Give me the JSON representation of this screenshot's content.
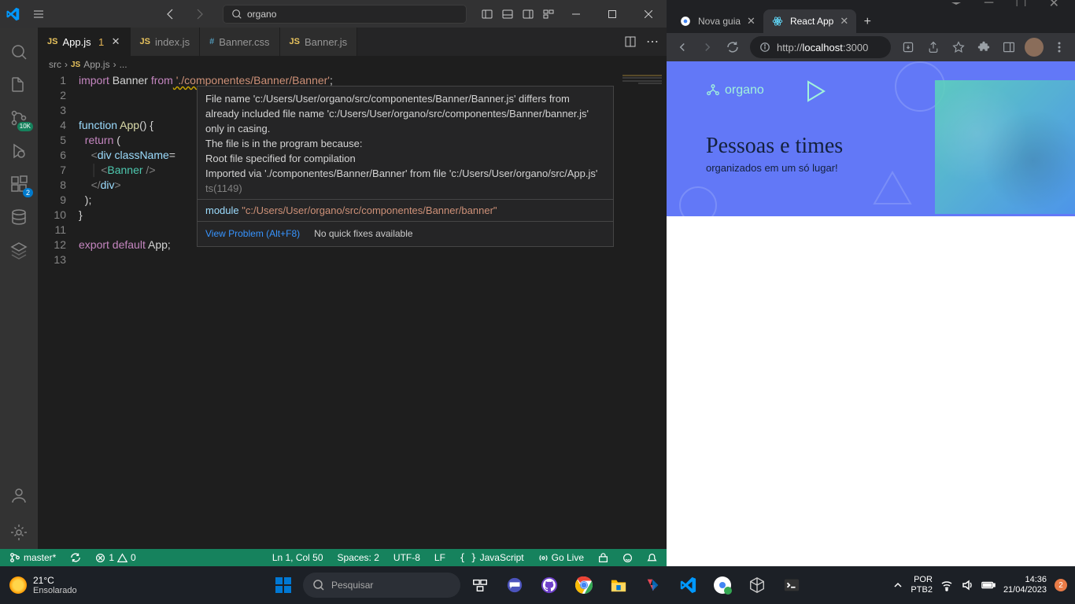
{
  "vscode": {
    "search": "organo",
    "tabs": [
      {
        "icon": "JS",
        "name": "App.js",
        "dirty": "1",
        "active": true
      },
      {
        "icon": "JS",
        "name": "index.js"
      },
      {
        "icon": "#",
        "name": "Banner.css",
        "css": true
      },
      {
        "icon": "JS",
        "name": "Banner.js"
      }
    ],
    "breadcrumb": {
      "p1": "src",
      "p2": "App.js",
      "p3": "..."
    },
    "lines": [
      "1",
      "2",
      "3",
      "4",
      "5",
      "6",
      "7",
      "8",
      "9",
      "10",
      "11",
      "12",
      "13"
    ],
    "code": {
      "l1_import": "import",
      "l1_name": " Banner ",
      "l1_from": "from",
      "l1_str": " './componentes/Banner/Banner'",
      "l1_semi": ";",
      "l4_fn": "function",
      "l4_name": " App",
      "l4_paren": "() {",
      "l5_ret": "return",
      "l5_paren": " (",
      "l6_open": "<",
      "l6_div": "div",
      "l6_attr": " className",
      "l6_eq": "=",
      "l7_open": "<",
      "l7_cmp": "Banner",
      "l7_close": " />",
      "l8_open": "</",
      "l8_div": "div",
      "l8_close": ">",
      "l9": ");",
      "l10": "}",
      "l12_exp": "export",
      "l12_def": " default",
      "l12_app": " App",
      "l12_semi": ";"
    },
    "hover": {
      "msg1": "File name 'c:/Users/User/organo/src/componentes/Banner/Banner.js' differs from already included file name 'c:/Users/User/organo/src/componentes/Banner/banner.js' only in casing.",
      "msg2": "  The file is in the program because:",
      "msg3": "    Root file specified for compilation",
      "msg4": "    Imported via './componentes/Banner/Banner' from file 'c:/Users/User/organo/src/App.js'",
      "tscode": " ts(1149)",
      "module": "module ",
      "moduleStr": "\"c:/Users/User/organo/src/componentes/Banner/banner\"",
      "viewProblem": "View Problem (Alt+F8)",
      "noQuick": "No quick fixes available"
    },
    "status": {
      "branch": "master*",
      "errors": "1",
      "warnings": "0",
      "pos": "Ln 1, Col 50",
      "spaces": "Spaces: 2",
      "enc": "UTF-8",
      "eol": "LF",
      "lang": "JavaScript",
      "golive": "Go Live"
    },
    "activity_badge_10k": "10K",
    "activity_badge_2": "2"
  },
  "chrome": {
    "tabs": [
      {
        "name": "Nova guia"
      },
      {
        "name": "React App",
        "active": true
      }
    ],
    "url_pre": "http://",
    "url_host": "localhost",
    "url_port": ":3000",
    "banner": {
      "logo": "organo",
      "headline": "Pessoas e times",
      "subtitle": "organizados em um só lugar!"
    }
  },
  "taskbar": {
    "temp": "21°C",
    "weather": "Ensolarado",
    "search": "Pesquisar",
    "lang1": "POR",
    "lang2": "PTB2",
    "time": "14:36",
    "date": "21/04/2023",
    "notif": "2"
  }
}
